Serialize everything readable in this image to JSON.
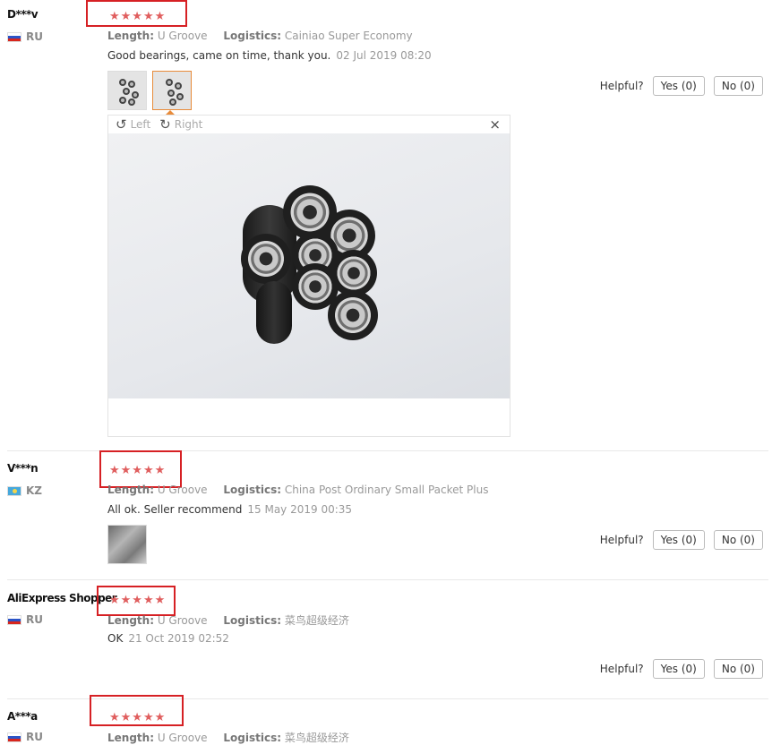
{
  "labels": {
    "length": "Length:",
    "logistics": "Logistics:",
    "helpful": "Helpful?",
    "yes": "Yes (0)",
    "no": "No (0)",
    "stars": "★★★★★"
  },
  "viewer": {
    "left_label": "Left",
    "right_label": "Right",
    "close_glyph": "×",
    "rotate_left_icon": "rotate-left-icon",
    "rotate_right_icon": "rotate-right-icon"
  },
  "colors": {
    "accent_red": "#d62024",
    "star": "#e05e5e",
    "active_thumb": "#e88b3a"
  },
  "reviews": [
    {
      "user": "D***v",
      "country": "RU",
      "rating": 5,
      "length": "U Groove",
      "logistics": "Cainiao Super Economy",
      "comment": "Good bearings, came on time, thank you.",
      "date": "02 Jul 2019 08:20"
    },
    {
      "user": "V***n",
      "country": "KZ",
      "rating": 5,
      "length": "U Groove",
      "logistics": "China Post Ordinary Small Packet Plus",
      "comment": "All ok. Seller recommend",
      "date": "15 May 2019 00:35"
    },
    {
      "user": "AliExpress Shopper",
      "country": "RU",
      "rating": 5,
      "length": "U Groove",
      "logistics": "菜鸟超级经济",
      "comment": "OK",
      "date": "21 Oct 2019 02:52"
    },
    {
      "user": "A***a",
      "country": "RU",
      "rating": 5,
      "length": "U Groove",
      "logistics": "菜鸟超级经济"
    }
  ]
}
